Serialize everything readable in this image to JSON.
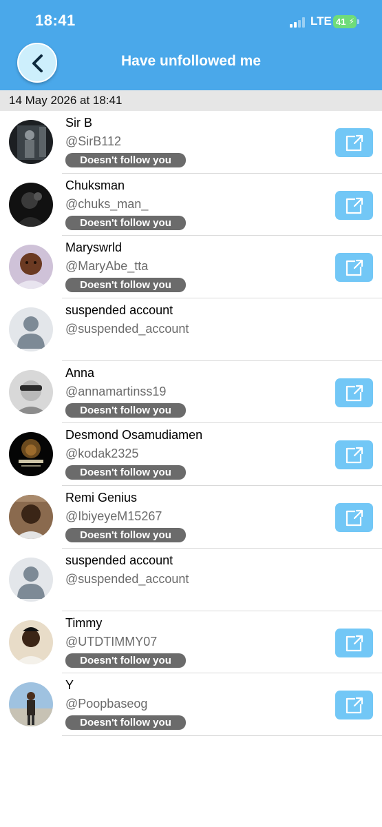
{
  "status_bar": {
    "time": "18:41",
    "network": "LTE",
    "battery": "41"
  },
  "header": {
    "title": "Have unfollowed me",
    "back_icon": "chevron-left-icon"
  },
  "date": "14 May 2026 at 18:41",
  "colors": {
    "header_bg": "#4aa8ea",
    "badge_bg": "#6b6b6b",
    "open_button_bg": "#72c7f6",
    "date_bar_bg": "#e6e6e6"
  },
  "users": [
    {
      "name": "Sir B",
      "handle": "@SirB112",
      "status": "Doesn't follow you",
      "avatar": "photo"
    },
    {
      "name": "Chuksman",
      "handle": "@chuks_man_",
      "status": "Doesn't follow you",
      "avatar": "photo"
    },
    {
      "name": "Maryswrld",
      "handle": "@MaryAbe_tta",
      "status": "Doesn't follow you",
      "avatar": "photo"
    },
    {
      "name": "suspended account",
      "handle": "@suspended_account",
      "status": "",
      "avatar": "placeholder"
    },
    {
      "name": "Anna",
      "handle": "@annamartinss19",
      "status": "Doesn't follow you",
      "avatar": "photo"
    },
    {
      "name": "Desmond Osamudiamen",
      "handle": "@kodak2325",
      "status": "Doesn't follow you",
      "avatar": "photo"
    },
    {
      "name": "Remi Genius",
      "handle": "@IbiyeyeM15267",
      "status": "Doesn't follow you",
      "avatar": "photo"
    },
    {
      "name": "suspended account",
      "handle": "@suspended_account",
      "status": "",
      "avatar": "placeholder"
    },
    {
      "name": "Timmy",
      "handle": "@UTDTIMMY07",
      "status": "Doesn't follow you",
      "avatar": "photo"
    },
    {
      "name": "Y",
      "handle": "@Poopbaseog",
      "status": "Doesn't follow you",
      "avatar": "photo"
    }
  ]
}
